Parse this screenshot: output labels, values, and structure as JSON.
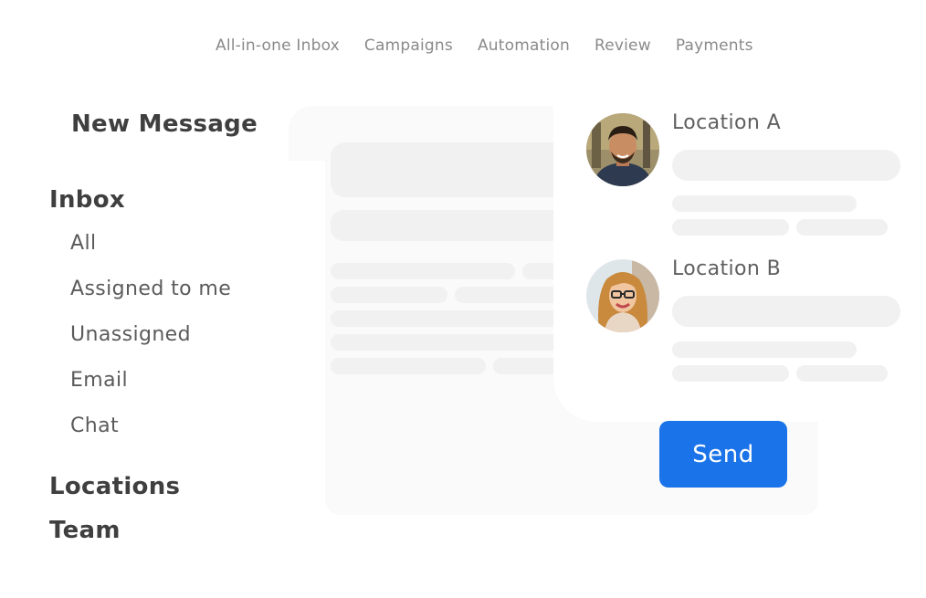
{
  "nav": {
    "items": [
      {
        "label": "All-in-one Inbox"
      },
      {
        "label": "Campaigns"
      },
      {
        "label": "Automation"
      },
      {
        "label": "Review"
      },
      {
        "label": "Payments"
      }
    ]
  },
  "sidebar": {
    "new_message": "New Message",
    "inbox_heading": "Inbox",
    "inbox_items": [
      {
        "label": "All"
      },
      {
        "label": "Assigned to me"
      },
      {
        "label": "Unassigned"
      },
      {
        "label": "Email"
      },
      {
        "label": "Chat"
      }
    ],
    "locations_heading": "Locations",
    "team_heading": "Team"
  },
  "locations": [
    {
      "name": "Location A",
      "avatar": "man-avatar"
    },
    {
      "name": "Location B",
      "avatar": "woman-avatar"
    }
  ],
  "compose": {
    "send_label": "Send",
    "accent_color": "#1a73e8"
  }
}
